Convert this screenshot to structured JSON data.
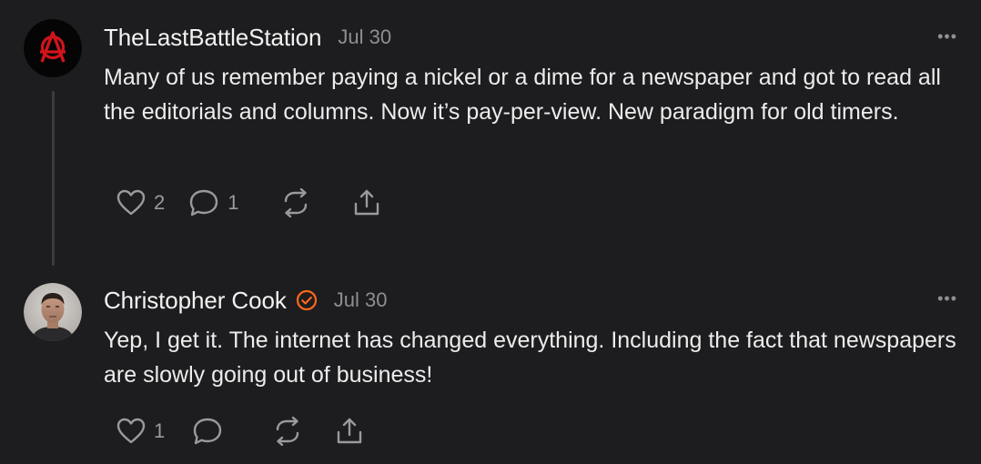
{
  "comments": [
    {
      "author": "TheLastBattleStation",
      "date": "Jul 30",
      "more": "•••",
      "body": "Many of us remember paying a nickel or a dime for a newspaper and got to read all the editorials and columns. Now it’s pay-per-view. New paradigm for old timers.",
      "likes": "2",
      "replies": "1",
      "avatar_icon": "anarchy-symbol-icon",
      "verified": false
    },
    {
      "author": "Christopher Cook",
      "date": "Jul 30",
      "more": "•••",
      "body": "Yep, I get it. The internet has changed everything. Including the fact that newspapers are slowly going out of business!",
      "likes": "1",
      "replies": "",
      "avatar_icon": "profile-photo",
      "verified": true
    }
  ],
  "colors": {
    "background": "#1d1d1f",
    "text": "#ececec",
    "muted": "#8e8e93",
    "verified": "#ff6719",
    "avatar_symbol": "#d1141b"
  }
}
